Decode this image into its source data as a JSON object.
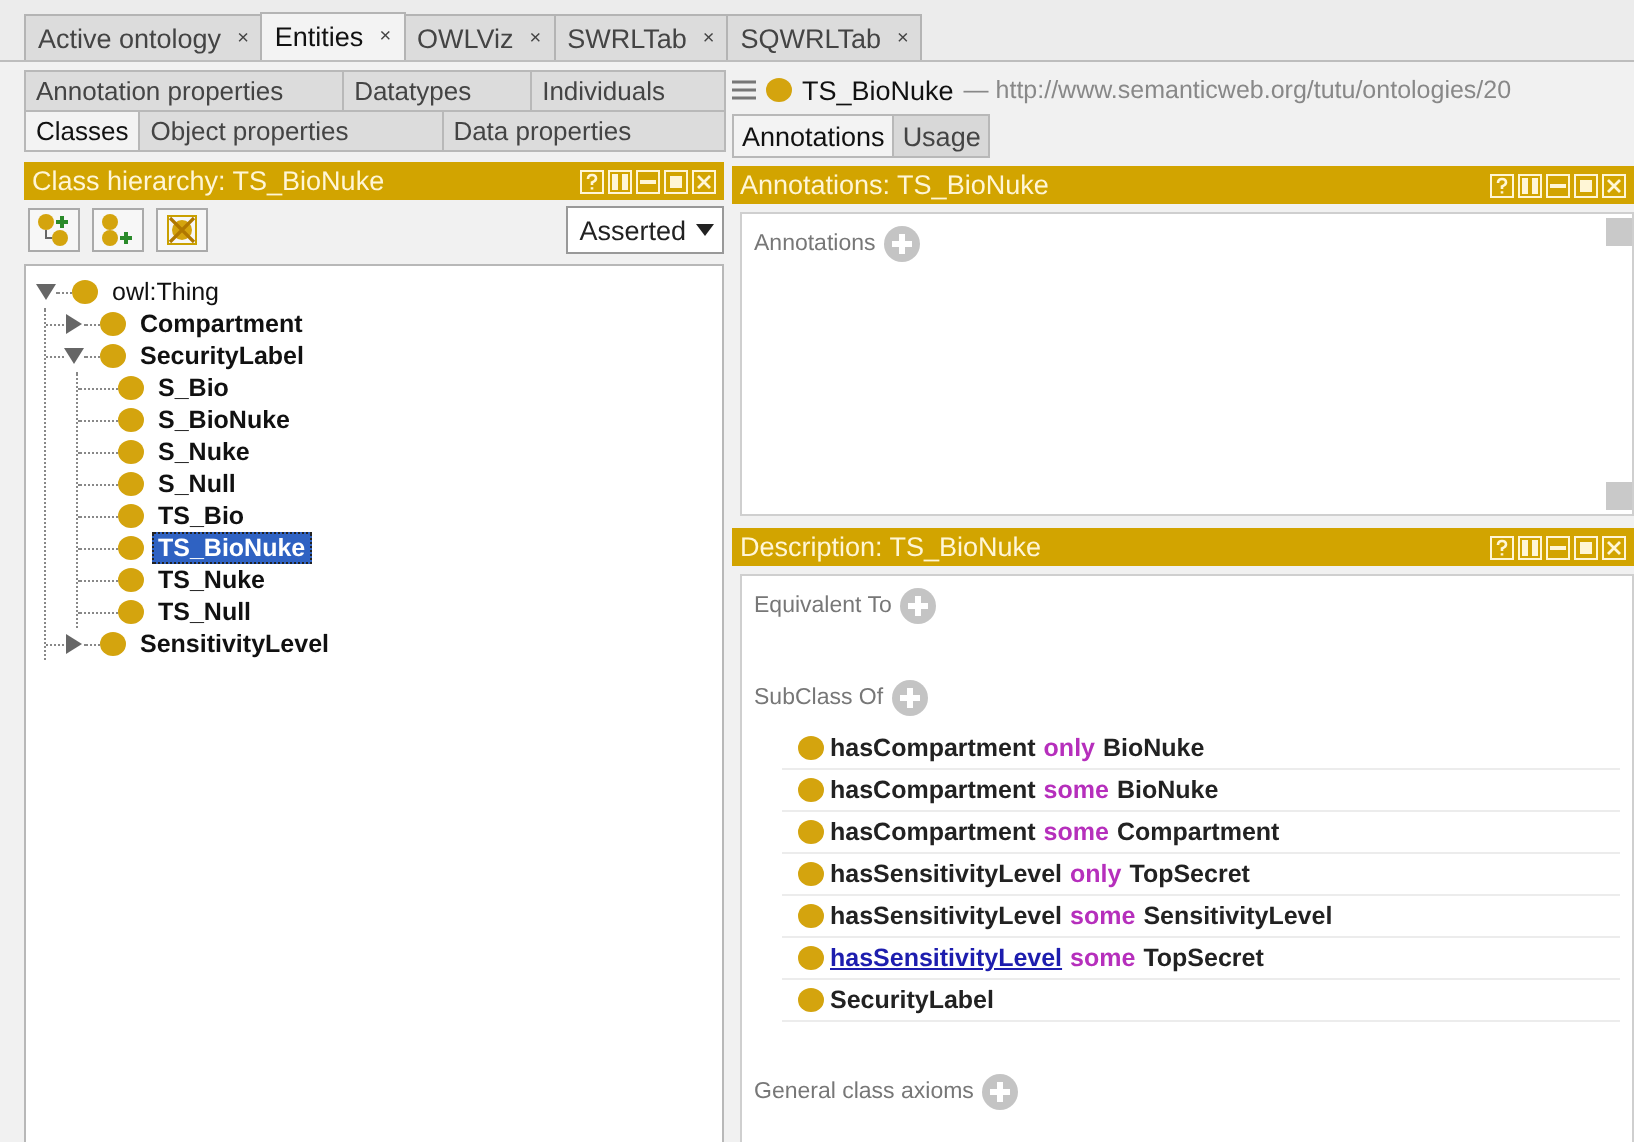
{
  "top_tabs": [
    {
      "label": "Active ontology",
      "close": "×",
      "selected": false
    },
    {
      "label": "Entities",
      "close": "×",
      "selected": true
    },
    {
      "label": "OWLViz",
      "close": "×",
      "selected": false
    },
    {
      "label": "SWRLTab",
      "close": "×",
      "selected": false
    },
    {
      "label": "SQWRLTab",
      "close": "×",
      "selected": false
    }
  ],
  "left": {
    "tab_rows": [
      [
        {
          "label": "Annotation properties",
          "selected": false
        },
        {
          "label": "Datatypes",
          "selected": false
        },
        {
          "label": "Individuals",
          "selected": false
        }
      ],
      [
        {
          "label": "Classes",
          "selected": true
        },
        {
          "label": "Object properties",
          "selected": false
        },
        {
          "label": "Data properties",
          "selected": false
        }
      ]
    ],
    "hierarchy": {
      "title": "Class hierarchy: TS_BioNuke",
      "view_mode": "Asserted",
      "tree": [
        {
          "label": "owl:Thing",
          "selected": false,
          "expanded": true,
          "children": [
            {
              "label": "Compartment",
              "selected": false,
              "expanded": false
            },
            {
              "label": "SecurityLabel",
              "selected": false,
              "expanded": true,
              "children": [
                {
                  "label": "S_Bio",
                  "selected": false
                },
                {
                  "label": "S_BioNuke",
                  "selected": false
                },
                {
                  "label": "S_Nuke",
                  "selected": false
                },
                {
                  "label": "S_Null",
                  "selected": false
                },
                {
                  "label": "TS_Bio",
                  "selected": false
                },
                {
                  "label": "TS_BioNuke",
                  "selected": true
                },
                {
                  "label": "TS_Nuke",
                  "selected": false
                },
                {
                  "label": "TS_Null",
                  "selected": false
                }
              ]
            },
            {
              "label": "SensitivityLevel",
              "selected": false,
              "expanded": false
            }
          ]
        }
      ]
    }
  },
  "right": {
    "entity": {
      "name": "TS_BioNuke",
      "iri": "— http://www.semanticweb.org/tutu/ontologies/20"
    },
    "tabs": [
      {
        "label": "Annotations",
        "selected": true
      },
      {
        "label": "Usage",
        "selected": false
      }
    ],
    "annotations_panel": {
      "title": "Annotations: TS_BioNuke",
      "sections": [
        {
          "label": "Annotations"
        }
      ]
    },
    "description_panel": {
      "title": "Description: TS_BioNuke",
      "sections": [
        {
          "label": "Equivalent To"
        },
        {
          "label": "SubClass Of",
          "axioms": [
            {
              "parts": [
                {
                  "kind": "property",
                  "text": "hasCompartment"
                },
                {
                  "kind": "keyword",
                  "text": "only"
                },
                {
                  "kind": "class",
                  "text": "BioNuke"
                }
              ]
            },
            {
              "parts": [
                {
                  "kind": "property",
                  "text": "hasCompartment"
                },
                {
                  "kind": "keyword",
                  "text": "some"
                },
                {
                  "kind": "class",
                  "text": "BioNuke"
                }
              ]
            },
            {
              "parts": [
                {
                  "kind": "property",
                  "text": "hasCompartment"
                },
                {
                  "kind": "keyword",
                  "text": "some"
                },
                {
                  "kind": "class",
                  "text": "Compartment"
                }
              ]
            },
            {
              "parts": [
                {
                  "kind": "property",
                  "text": "hasSensitivityLevel"
                },
                {
                  "kind": "keyword",
                  "text": "only"
                },
                {
                  "kind": "class",
                  "text": "TopSecret"
                }
              ]
            },
            {
              "parts": [
                {
                  "kind": "property",
                  "text": "hasSensitivityLevel"
                },
                {
                  "kind": "keyword",
                  "text": "some"
                },
                {
                  "kind": "class",
                  "text": "SensitivityLevel"
                }
              ]
            },
            {
              "parts": [
                {
                  "kind": "link",
                  "text": "hasSensitivityLevel"
                },
                {
                  "kind": "keyword",
                  "text": "some"
                },
                {
                  "kind": "class",
                  "text": "TopSecret"
                }
              ]
            },
            {
              "parts": [
                {
                  "kind": "class",
                  "text": "SecurityLabel"
                }
              ]
            }
          ]
        },
        {
          "label": "General class axioms"
        }
      ]
    }
  }
}
